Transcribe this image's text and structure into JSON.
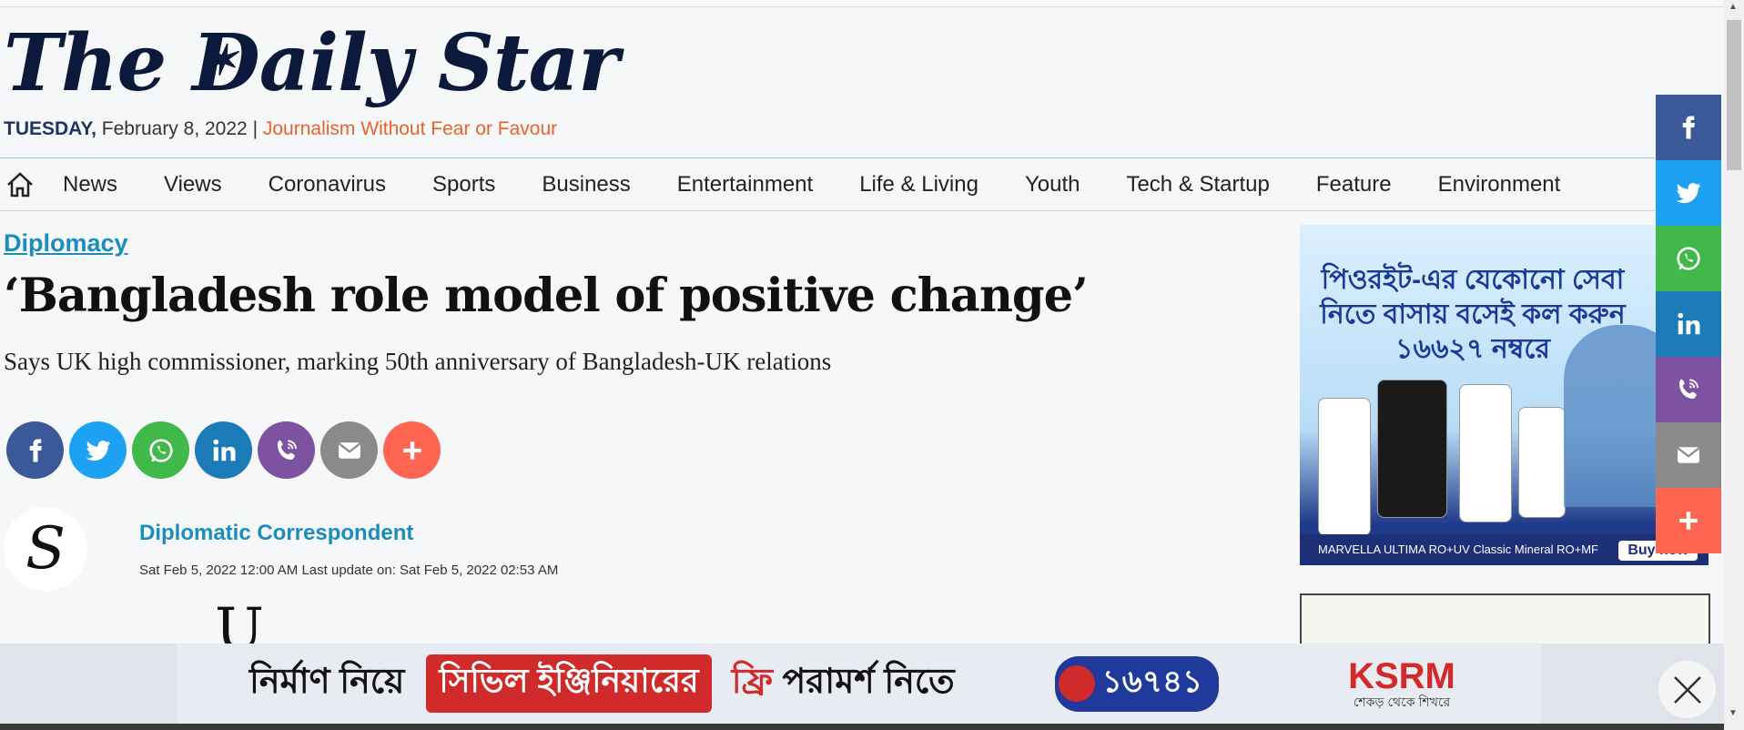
{
  "masthead": {
    "logo_text": "The Daily Star",
    "day": "TUESDAY,",
    "date": "February 8, 2022",
    "separator": "|",
    "motto": "Journalism Without Fear or Favour"
  },
  "nav": {
    "home_icon": "home-icon",
    "items": [
      "News",
      "Views",
      "Coronavirus",
      "Sports",
      "Business",
      "Entertainment",
      "Life & Living",
      "Youth",
      "Tech & Startup",
      "Feature",
      "Environment"
    ]
  },
  "article": {
    "category": "Diplomacy",
    "headline": "‘Bangladesh role model of positive change’",
    "subhead": "Says UK high commissioner, marking 50th anniversary of Bangladesh-UK relations",
    "author": "Diplomatic Correspondent",
    "author_avatar_letter": "S",
    "dates": "Sat Feb 5, 2022 12:00 AM Last update on: Sat Feb 5, 2022 02:53 AM",
    "dropcap": "U"
  },
  "share_buttons": [
    {
      "name": "facebook",
      "color": "#3b5998"
    },
    {
      "name": "twitter",
      "color": "#1da1f2"
    },
    {
      "name": "whatsapp",
      "color": "#40b84a"
    },
    {
      "name": "linkedin",
      "color": "#1a7bb8"
    },
    {
      "name": "viber",
      "color": "#7d52a0"
    },
    {
      "name": "email",
      "color": "#8a8a8a"
    },
    {
      "name": "more",
      "color": "#ff6550"
    }
  ],
  "side_ad": {
    "text": "পিওরইট-এর যেকোনো সেবা নিতে বাসায় বসেই কল করুন ১৬৬২৭ নম্বরে",
    "products": "MARVELLA    ULTIMA RO+UV    Classic    Mineral RO+MF",
    "buy": "Buy now"
  },
  "bottom_ad": {
    "text1": "নির্মাণ নিয়ে",
    "text2": "সিভিল ইঞ্জিনিয়ারের",
    "text3_red": "ফ্রি",
    "text3": "পরামর্শ নিতে",
    "phone": "১৬৭৪১",
    "brand": "KSRM",
    "brand_tag": "শেকড় থেকে শিখরে"
  },
  "colors": {
    "accent_blue": "#1b8dbd",
    "navy": "#1f3461",
    "orange": "#e8632b"
  }
}
